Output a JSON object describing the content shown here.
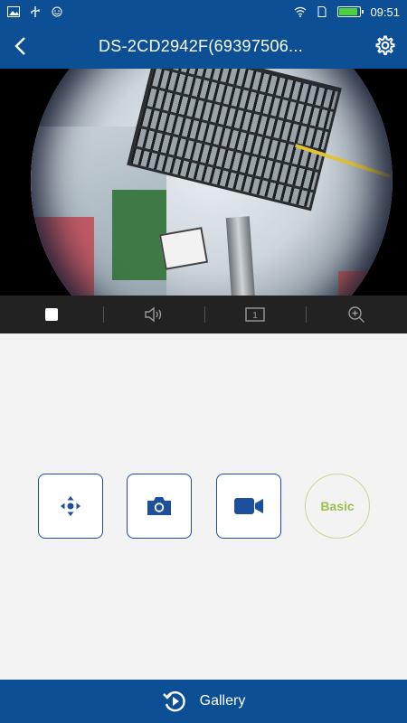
{
  "status_bar": {
    "time": "09:51",
    "left_icons": [
      "image-icon",
      "usb-icon",
      "face-icon"
    ],
    "right_icons": [
      "wifi-icon",
      "sim-icon",
      "battery-icon"
    ],
    "battery_level": 0.9
  },
  "header": {
    "title": "DS-2CD2942F(69397506..."
  },
  "controls": {
    "items": [
      "stop-icon",
      "volume-icon",
      "window-split-icon",
      "zoom-in-icon"
    ],
    "split_number": "1"
  },
  "actions": {
    "ptz": "ptz-icon",
    "capture": "camera-icon",
    "record": "video-camera-icon",
    "quality_label": "Basic"
  },
  "footer": {
    "gallery_label": "Gallery"
  },
  "colors": {
    "primary": "#0c4f94",
    "accent_blue": "#1c4f9c",
    "basic_green": "#9dbf4f",
    "control_bg": "#222222"
  }
}
